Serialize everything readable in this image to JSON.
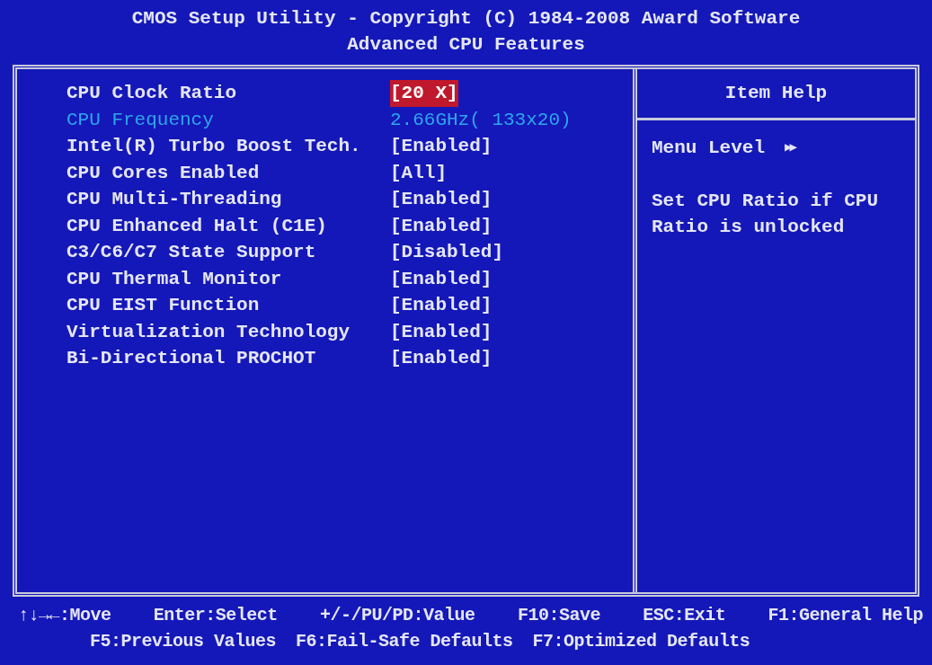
{
  "header": {
    "title": "CMOS Setup Utility - Copyright (C) 1984-2008 Award Software",
    "subtitle": "Advanced CPU Features"
  },
  "settings": [
    {
      "label": "CPU Clock Ratio",
      "value": "[20 X]",
      "kind": "setting",
      "selected": true
    },
    {
      "label": "CPU Frequency",
      "value": "2.66GHz( 133x20)",
      "kind": "info",
      "selected": false
    },
    {
      "label": "Intel(R) Turbo Boost Tech.",
      "value": "[Enabled]",
      "kind": "setting",
      "selected": false
    },
    {
      "label": "CPU Cores Enabled",
      "value": "[All]",
      "kind": "setting",
      "selected": false
    },
    {
      "label": "CPU Multi-Threading",
      "value": "[Enabled]",
      "kind": "setting",
      "selected": false
    },
    {
      "label": "CPU Enhanced Halt (C1E)",
      "value": "[Enabled]",
      "kind": "setting",
      "selected": false
    },
    {
      "label": "C3/C6/C7 State Support",
      "value": "[Disabled]",
      "kind": "setting",
      "selected": false
    },
    {
      "label": "CPU Thermal Monitor",
      "value": "[Enabled]",
      "kind": "setting",
      "selected": false
    },
    {
      "label": "CPU EIST Function",
      "value": "[Enabled]",
      "kind": "setting",
      "selected": false
    },
    {
      "label": "Virtualization Technology",
      "value": "[Enabled]",
      "kind": "setting",
      "selected": false
    },
    {
      "label": "Bi-Directional PROCHOT",
      "value": "[Enabled]",
      "kind": "setting",
      "selected": false
    }
  ],
  "item_help": {
    "title": "Item Help",
    "menu_level": "Menu Level",
    "menu_level_marker": "▶▶",
    "text": "Set CPU Ratio if CPU Ratio is unlocked"
  },
  "footer": [
    [
      "↑↓→←:Move",
      "Enter:Select",
      "+/-/PU/PD:Value",
      "F10:Save",
      "ESC:Exit",
      "F1:General Help"
    ],
    [
      "F5:Previous Values",
      "F6:Fail-Safe Defaults",
      "F7:Optimized Defaults"
    ]
  ]
}
